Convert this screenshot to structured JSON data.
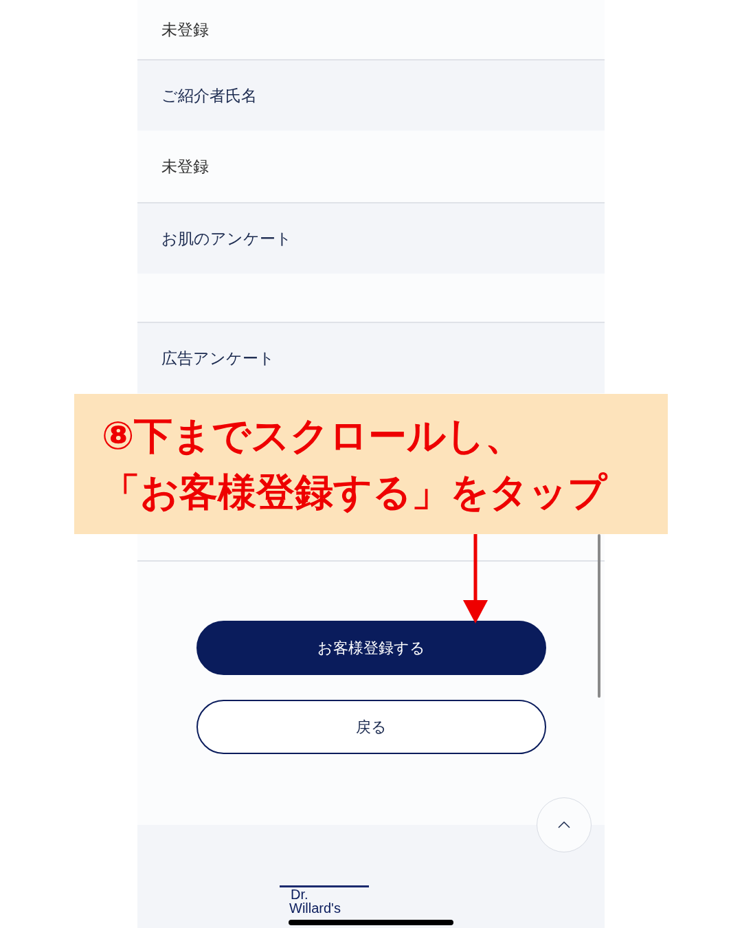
{
  "rows": [
    {
      "kind": "value",
      "text": "未登録"
    },
    {
      "kind": "label",
      "text": "ご紹介者氏名"
    },
    {
      "kind": "value",
      "text": "未登録"
    },
    {
      "kind": "label",
      "text": "お肌のアンケート"
    },
    {
      "kind": "value"
    },
    {
      "kind": "label",
      "text": "広告アンケート"
    },
    {
      "kind": "value"
    }
  ],
  "buttons": [
    {
      "kind": "primary",
      "label": "お客様登録する"
    },
    {
      "kind": "secondary",
      "label": "戻る"
    }
  ],
  "footer": {
    "logo_top": "Dr.",
    "logo_bottom": "Willard's"
  },
  "annotation": {
    "lines": [
      "⑧下までスクロールし、",
      "「お客様登録する」をタップ"
    ]
  }
}
